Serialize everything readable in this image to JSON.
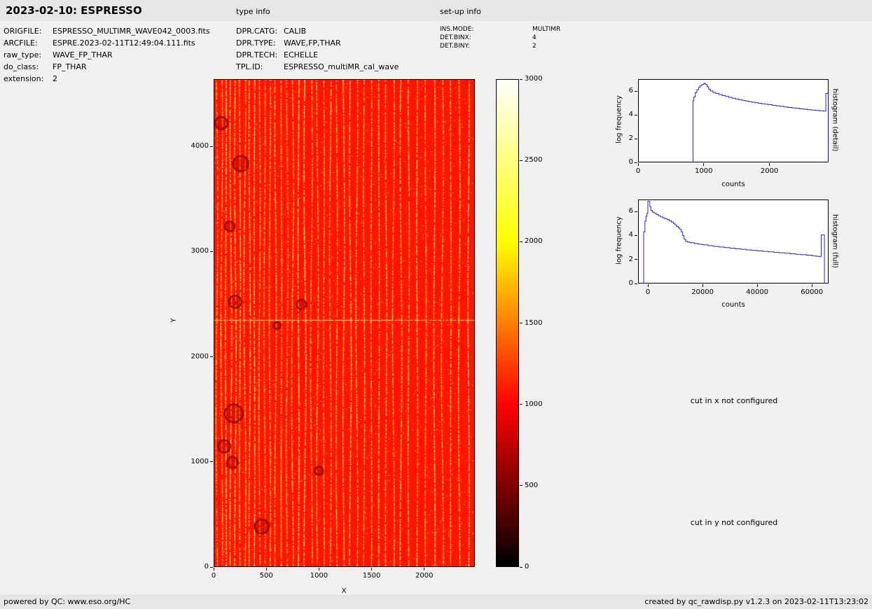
{
  "header": {
    "title": "2023-02-10: ESPRESSO",
    "type_info": "type info",
    "setup_info": "set-up info"
  },
  "file_info": [
    {
      "label": "ORIGFILE:",
      "value": "ESPRESSO_MULTIMR_WAVE042_0003.fits"
    },
    {
      "label": "ARCFILE:",
      "value": "ESPRE.2023-02-11T12:49:04.111.fits"
    },
    {
      "label": "raw_type:",
      "value": "WAVE_FP_THAR"
    },
    {
      "label": "do_class:",
      "value": "FP_THAR"
    },
    {
      "label": "extension:",
      "value": "2"
    }
  ],
  "type_info": [
    {
      "label": "DPR.CATG:",
      "value": "CALIB"
    },
    {
      "label": "DPR.TYPE:",
      "value": "WAVE,FP,THAR"
    },
    {
      "label": "DPR.TECH:",
      "value": "ECHELLE"
    },
    {
      "label": "TPL.ID:",
      "value": "ESPRESSO_multiMR_cal_wave"
    }
  ],
  "setup_info": [
    {
      "label": "INS.MODE:",
      "value": "MULTIMR"
    },
    {
      "label": "DET.BINX:",
      "value": "4"
    },
    {
      "label": "DET.BINY:",
      "value": "2"
    }
  ],
  "notes": {
    "cut_x": "cut in x not configured",
    "cut_y": "cut in y not configured"
  },
  "footer": {
    "left": "powered by QC: www.eso.org/HC",
    "right": "created by qc_rawdisp.py v1.2.3 on 2023-02-11T13:23:02"
  },
  "chart_data": [
    {
      "id": "raw_frame",
      "type": "heatmap",
      "xlabel": "X",
      "ylabel": "Y",
      "xlim": [
        0,
        2480
      ],
      "ylim": [
        0,
        4640
      ],
      "xticks": [
        0,
        500,
        1000,
        1500,
        2000
      ],
      "yticks": [
        0,
        1000,
        2000,
        3000,
        4000
      ],
      "colormap": "hot",
      "colorbar": {
        "min": 0,
        "max": 3000,
        "ticks": [
          0,
          500,
          1000,
          1500,
          2000,
          2500,
          3000
        ]
      },
      "content": "ESPRESSO raw echelle calibration frame: ~40 bright dotted vertical FP/ThAr order stripes (counts ~1500-3000) on red background (~1080 counts), horizontal detector seam at y=2350, dark low-count blobs near the left edge, scattered hot pixels",
      "render": {
        "background_value": 1080,
        "mottle_range": [
          900,
          1260
        ],
        "stripe_value_range": [
          1500,
          3000
        ],
        "stripe_spacing_px": [
          6.2,
          13.2
        ],
        "seam_y_data": 2350,
        "seed": 42
      }
    },
    {
      "id": "histogram_detail",
      "type": "line",
      "xlabel": "counts",
      "ylabel": "log frequency",
      "right_label": "histogram (detail)",
      "line_color": "#2222cc",
      "xlim": [
        0,
        2900
      ],
      "ylim": [
        0,
        7
      ],
      "xticks": [
        0,
        1000,
        2000
      ],
      "yticks": [
        0,
        2,
        4,
        6
      ],
      "x": [
        836,
        836,
        850,
        870,
        895,
        920,
        945,
        970,
        1000,
        1025,
        1050,
        1075,
        1100,
        1140,
        1180,
        1230,
        1280,
        1330,
        1380,
        1430,
        1480,
        1530,
        1580,
        1630,
        1680,
        1730,
        1780,
        1830,
        1880,
        1930,
        1980,
        2040,
        2100,
        2160,
        2220,
        2280,
        2340,
        2400,
        2460,
        2520,
        2580,
        2640,
        2700,
        2760,
        2820,
        2858,
        2858,
        2900,
        2900
      ],
      "y": [
        0,
        5.2,
        5.5,
        5.85,
        6.1,
        6.3,
        6.45,
        6.55,
        6.65,
        6.55,
        6.35,
        6.15,
        6.0,
        5.88,
        5.8,
        5.7,
        5.62,
        5.55,
        5.47,
        5.4,
        5.33,
        5.27,
        5.21,
        5.16,
        5.11,
        5.06,
        5.01,
        4.97,
        4.93,
        4.89,
        4.85,
        4.8,
        4.75,
        4.71,
        4.66,
        4.62,
        4.58,
        4.54,
        4.5,
        4.47,
        4.43,
        4.4,
        4.37,
        4.34,
        4.31,
        4.31,
        5.8,
        5.8,
        0
      ]
    },
    {
      "id": "histogram_full",
      "type": "line",
      "xlabel": "counts",
      "ylabel": "log frequency",
      "right_label": "histogram (full)",
      "line_color": "#2222cc",
      "xlim": [
        -3600,
        66100
      ],
      "ylim": [
        0,
        7
      ],
      "xticks": [
        0,
        20000,
        40000,
        60000
      ],
      "yticks": [
        0,
        2,
        4,
        6
      ],
      "x": [
        -1550,
        -1550,
        -1100,
        -700,
        -350,
        -50,
        0,
        450,
        700,
        1100,
        1600,
        2200,
        3000,
        3800,
        4600,
        5400,
        6200,
        7000,
        7800,
        8600,
        9300,
        9900,
        10500,
        11100,
        11700,
        12200,
        12700,
        13200,
        13800,
        14500,
        15500,
        17000,
        18500,
        20000,
        22000,
        24000,
        26000,
        28000,
        30000,
        32000,
        34000,
        36000,
        38000,
        40000,
        42000,
        44000,
        46000,
        48000,
        50000,
        52000,
        54000,
        56000,
        58000,
        60000,
        61500,
        62700,
        63400,
        63400,
        64600,
        64600
      ],
      "y": [
        0,
        4.3,
        5.2,
        5.6,
        5.85,
        6.0,
        6.85,
        6.85,
        6.4,
        6.1,
        5.95,
        5.88,
        5.75,
        5.65,
        5.56,
        5.48,
        5.4,
        5.32,
        5.22,
        5.12,
        5.0,
        4.88,
        4.75,
        4.62,
        4.5,
        4.3,
        4.0,
        3.7,
        3.52,
        3.45,
        3.4,
        3.33,
        3.27,
        3.22,
        3.15,
        3.09,
        3.04,
        2.99,
        2.94,
        2.89,
        2.85,
        2.8,
        2.76,
        2.72,
        2.68,
        2.64,
        2.6,
        2.56,
        2.52,
        2.48,
        2.44,
        2.4,
        2.36,
        2.31,
        2.27,
        2.24,
        2.22,
        4.05,
        4.05,
        0
      ]
    }
  ]
}
